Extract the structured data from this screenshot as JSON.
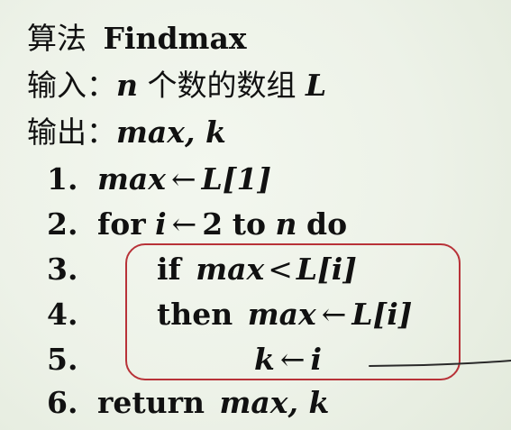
{
  "title": {
    "prefix": "算法",
    "name": "Findmax"
  },
  "input": {
    "label": "输入：",
    "n": "n",
    "text": " 个数的数组 ",
    "array": "L"
  },
  "output": {
    "label": "输出：",
    "vars": "max, k"
  },
  "steps": [
    {
      "num": "1.",
      "lhs": "max",
      "arrow": "←",
      "rhs": "L[1]"
    },
    {
      "num": "2.",
      "kw1": "for",
      "var": "i",
      "arrow": "←",
      "from": "2",
      "kw2": "to",
      "to": "n",
      "kw3": "do"
    },
    {
      "num": "3.",
      "kw": "if",
      "lhs": "max",
      "op": "<",
      "rhs": "L[i]"
    },
    {
      "num": "4.",
      "kw": "then",
      "lhs": "max",
      "arrow": "←",
      "rhs": "L[i]"
    },
    {
      "num": "5.",
      "lhs": "k",
      "arrow": "←",
      "rhs": "i"
    },
    {
      "num": "6.",
      "kw": "return",
      "vars": "max, k"
    }
  ],
  "colors": {
    "highlight": "#b83238",
    "annotation_line": "#2a2a2a"
  }
}
